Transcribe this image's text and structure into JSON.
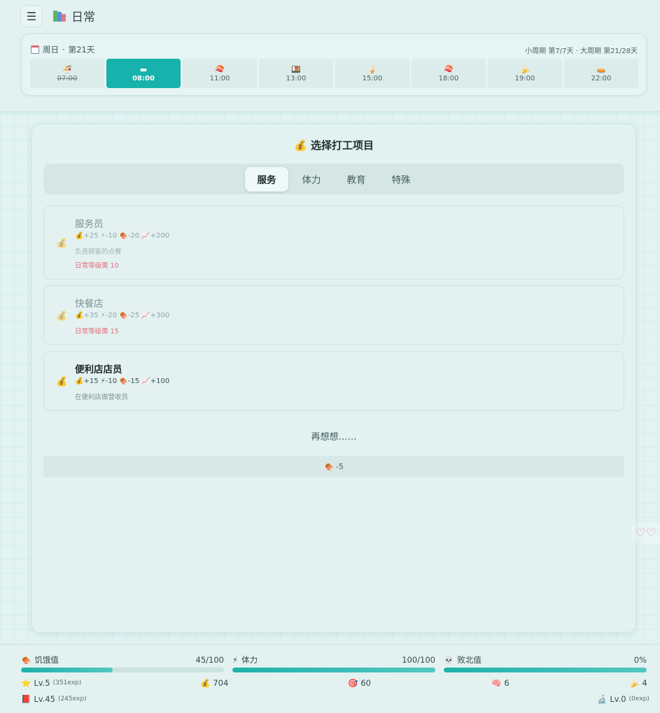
{
  "header": {
    "title": "日常",
    "day_label": "周日",
    "day_count": "第21天",
    "cycle_info": "小周期 第7/7天 · 大周期 第21/28天"
  },
  "time_slots": [
    {
      "icon": "🍜",
      "time": "07:00",
      "state": "past"
    },
    {
      "icon": "▬",
      "time": "08:00",
      "state": "active"
    },
    {
      "icon": "🍣",
      "time": "11:00",
      "state": "future"
    },
    {
      "icon": "🍱",
      "time": "13:00",
      "state": "future"
    },
    {
      "icon": "🍦",
      "time": "15:00",
      "state": "future"
    },
    {
      "icon": "🍣",
      "time": "18:00",
      "state": "future"
    },
    {
      "icon": "🍌",
      "time": "19:00",
      "state": "future"
    },
    {
      "icon": "🥧",
      "time": "22:00",
      "state": "future"
    }
  ],
  "dialog": {
    "title": "选择打工项目",
    "tabs": [
      "服务",
      "体力",
      "教育",
      "特殊"
    ],
    "active_tab": "服务",
    "jobs": [
      {
        "name": "服务员",
        "money": "+25",
        "energy": "-10",
        "hunger": "-20",
        "exp": "+200",
        "desc": "负责顾客的点餐",
        "requirement": "日常等级需 10",
        "locked": true
      },
      {
        "name": "快餐店",
        "money": "+35",
        "energy": "-20",
        "hunger": "-25",
        "exp": "+300",
        "desc": "",
        "requirement": "日常等级需 15",
        "locked": true
      },
      {
        "name": "便利店店员",
        "money": "+15",
        "energy": "-10",
        "hunger": "-15",
        "exp": "+100",
        "desc": "在便利店做营收员",
        "requirement": "",
        "locked": false
      }
    ],
    "rethink_label": "再想想……",
    "rethink_cost": "-5"
  },
  "status": {
    "hunger": {
      "label": "饥饿值",
      "value_text": "45/100",
      "fraction": 0.45
    },
    "energy": {
      "label": "体力",
      "value_text": "100/100",
      "fraction": 1.0
    },
    "defeat": {
      "label": "败北值",
      "value_text": "0%",
      "fraction": 1.0
    },
    "level": {
      "label": "Lv.5",
      "exp": "(351exp)"
    },
    "money": "704",
    "target": "60",
    "brain": "6",
    "banana": "4",
    "level2": {
      "label": "Lv.45",
      "exp": "(245exp)"
    },
    "level3": {
      "label": "Lv.0",
      "exp": "(0exp)"
    }
  },
  "colors": {
    "accent": "#16b2ab",
    "requirement": "#e26d7d"
  }
}
